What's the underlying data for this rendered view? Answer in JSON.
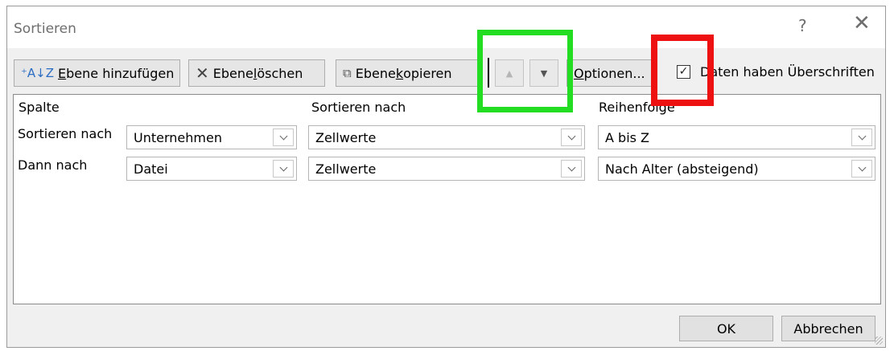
{
  "window": {
    "title": "Sortieren",
    "help_glyph": "?",
    "close_glyph": "✕"
  },
  "toolbar": {
    "add_icon": "⁺A↓Z",
    "add_label_u": "E",
    "add_label_rest": "bene hinzufügen",
    "delete_icon": "✕",
    "delete_label_a": "Ebene ",
    "delete_label_u": "l",
    "delete_label_rest": "öschen",
    "copy_icon": "⧉",
    "copy_label_a": "Ebene ",
    "copy_label_u": "k",
    "copy_label_rest": "opieren",
    "move_up_glyph": "▲",
    "move_down_glyph": "▼",
    "options_label_u": "O",
    "options_label_rest": "ptionen...",
    "headers_checkbox_mark": "✓",
    "headers_checkbox_label": "Daten haben Überschriften",
    "headers_checkbox_checked": true
  },
  "table": {
    "columns": [
      "Spalte",
      "Sortieren nach",
      "Reihenfolge"
    ],
    "rows": [
      {
        "label": "Sortieren nach",
        "column": "Unternehmen",
        "sort_on": "Zellwerte",
        "order": "A bis Z"
      },
      {
        "label": "Dann nach",
        "column": "Datei",
        "sort_on": "Zellwerte",
        "order": "Nach Alter (absteigend)"
      }
    ]
  },
  "footer": {
    "ok_label": "OK",
    "cancel_label": "Abbrechen"
  },
  "highlights": {
    "green": "#22dd22",
    "red": "#ee1111"
  }
}
